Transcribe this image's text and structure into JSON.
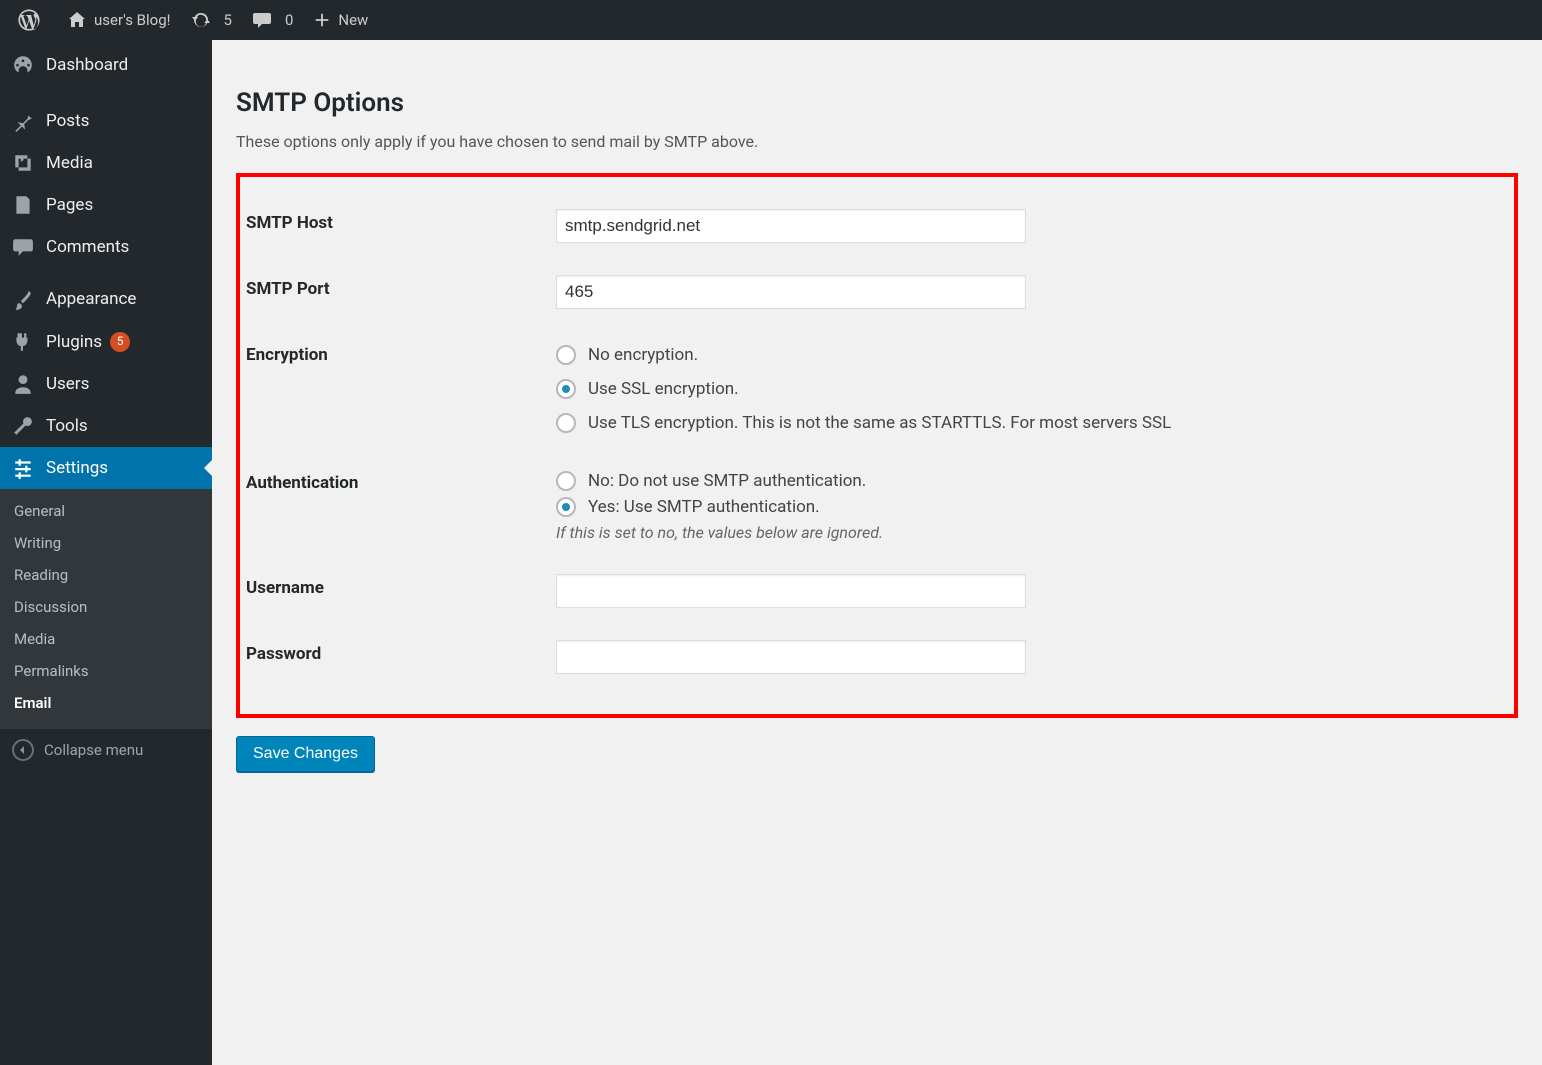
{
  "adminbar": {
    "site_title": "user's Blog!",
    "updates_count": "5",
    "comments_count": "0",
    "new_label": "New"
  },
  "sidebar": {
    "items": [
      {
        "id": "dashboard",
        "label": "Dashboard"
      },
      {
        "id": "posts",
        "label": "Posts"
      },
      {
        "id": "media",
        "label": "Media"
      },
      {
        "id": "pages",
        "label": "Pages"
      },
      {
        "id": "comments",
        "label": "Comments"
      },
      {
        "id": "appearance",
        "label": "Appearance"
      },
      {
        "id": "plugins",
        "label": "Plugins",
        "badge": "5"
      },
      {
        "id": "users",
        "label": "Users"
      },
      {
        "id": "tools",
        "label": "Tools"
      },
      {
        "id": "settings",
        "label": "Settings"
      }
    ],
    "submenu": [
      {
        "label": "General"
      },
      {
        "label": "Writing"
      },
      {
        "label": "Reading"
      },
      {
        "label": "Discussion"
      },
      {
        "label": "Media"
      },
      {
        "label": "Permalinks"
      },
      {
        "label": "Email",
        "current": true
      }
    ],
    "collapse_label": "Collapse menu"
  },
  "page": {
    "section_title": "SMTP Options",
    "section_desc": "These options only apply if you have chosen to send mail by SMTP above.",
    "fields": {
      "smtp_host_label": "SMTP Host",
      "smtp_host_value": "smtp.sendgrid.net",
      "smtp_port_label": "SMTP Port",
      "smtp_port_value": "465",
      "encryption_label": "Encryption",
      "encryption_options": {
        "none": "No encryption.",
        "ssl": "Use SSL encryption.",
        "tls": "Use TLS encryption. This is not the same as STARTTLS. For most servers SSL"
      },
      "encryption_selected": "ssl",
      "auth_label": "Authentication",
      "auth_options": {
        "no": "No: Do not use SMTP authentication.",
        "yes": "Yes: Use SMTP authentication."
      },
      "auth_selected": "yes",
      "auth_note": "If this is set to no, the values below are ignored.",
      "username_label": "Username",
      "username_value": "",
      "password_label": "Password",
      "password_value": ""
    },
    "save_button": "Save Changes"
  }
}
